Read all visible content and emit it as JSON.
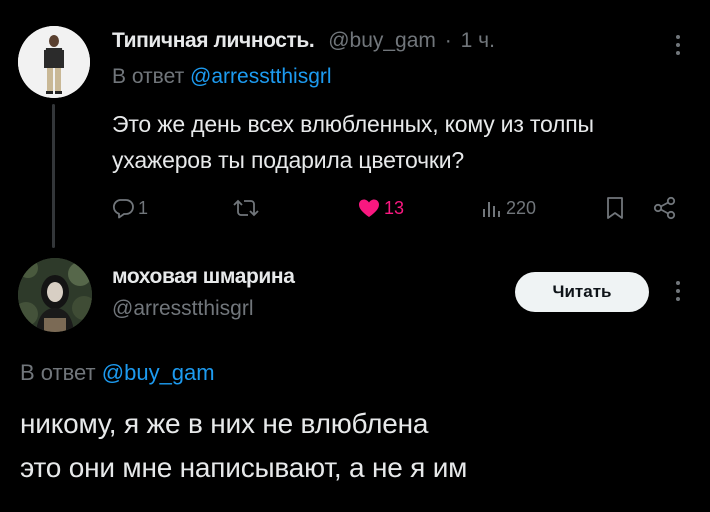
{
  "parent_tweet": {
    "author_name": "Типичная личность.",
    "handle": "@buy_gam",
    "separator": "·",
    "time": "1 ч.",
    "reply_label": "В ответ",
    "reply_to": "@arresstthisgrl",
    "text": "Это же день всех влюбленных, кому из толпы ухажеров ты подарила цветочки?",
    "actions": {
      "reply_count": "1",
      "retweet_count": "",
      "like_count": "13",
      "views_count": "220"
    }
  },
  "reply_tweet": {
    "author_name": "моховая шмарина",
    "handle": "@arresstthisgrl",
    "follow_label": "Читать",
    "reply_label": "В ответ",
    "reply_to": "@buy_gam",
    "text_lines": [
      "никому, я же в них не влюблена",
      "это они мне написывают, а не я им"
    ]
  },
  "icons": {
    "reply": "comment-icon",
    "retweet": "retweet-icon",
    "like": "heart-icon",
    "views": "views-icon",
    "bookmark": "bookmark-icon",
    "share": "share-icon",
    "more": "more-vertical-icon"
  },
  "colors": {
    "background": "#000000",
    "text": "#e7e9ea",
    "muted": "#71767b",
    "link": "#1d9bf0",
    "like": "#f91880",
    "button_bg": "#eff3f4"
  }
}
